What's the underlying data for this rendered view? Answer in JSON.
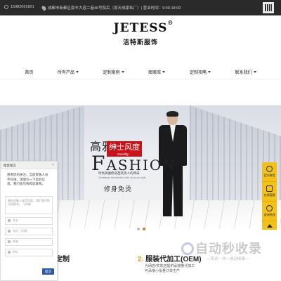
{
  "topbar": {
    "phone": "15982061821",
    "address": "成都市新都区南丰大道二巷46号院后（原天成家私厂）| 营业时间：9:00-18:00"
  },
  "brand": {
    "name_en": "JETESS",
    "registered": "®",
    "name_cn": "洁特斯服饰"
  },
  "nav": {
    "items": [
      {
        "label": "首页",
        "has_caret": false
      },
      {
        "label": "所有产品",
        "has_caret": true
      },
      {
        "label": "定制案例",
        "has_caret": true
      },
      {
        "label": "图案库",
        "has_caret": true
      },
      {
        "label": "定制攻略",
        "has_caret": true
      },
      {
        "label": "联系我们",
        "has_caret": true
      }
    ]
  },
  "banner": {
    "gaoya": "高雅",
    "redbox": "绅士风度",
    "gentility": "Gentility",
    "fashion_big": "F",
    "fashion_rest": "ASHION",
    "sub1": "时尚高雅修身西装男人的神采",
    "sub2": "Gentleman fashionable suits show our style",
    "xiushen": "修身免烫",
    "dots": [
      false,
      true
    ]
  },
  "services": {
    "item1_title": "定制",
    "item2_num": "2.",
    "item2_title": "服装代加工(OEM)",
    "item2_desc1": "为网店/实体店提供承接量代加工",
    "item2_desc2": "可承接小批量订单生产"
  },
  "watermark": {
    "text": "自动秒收录",
    "sub": "—来访一次—自动收录—"
  },
  "panel": {
    "title": "给您留言",
    "close": "×",
    "message": "感谢您的关注，当前客服人员不在线，请填写一下您的信息，我们会尽快和您联系。",
    "textarea_placeholder": "请在此输入留言内容，我们会尽快与您联系。（必填）",
    "fields": [
      "姓名",
      "电话（必填）",
      "邮箱",
      "地址"
    ],
    "send": "提交"
  },
  "rightbar": {
    "items": [
      {
        "label": "官方微信",
        "icon": "wechat-icon"
      },
      {
        "label": "在线客服",
        "icon": "chat-icon"
      },
      {
        "label": "咨询热线",
        "icon": "phone-icon"
      }
    ]
  }
}
